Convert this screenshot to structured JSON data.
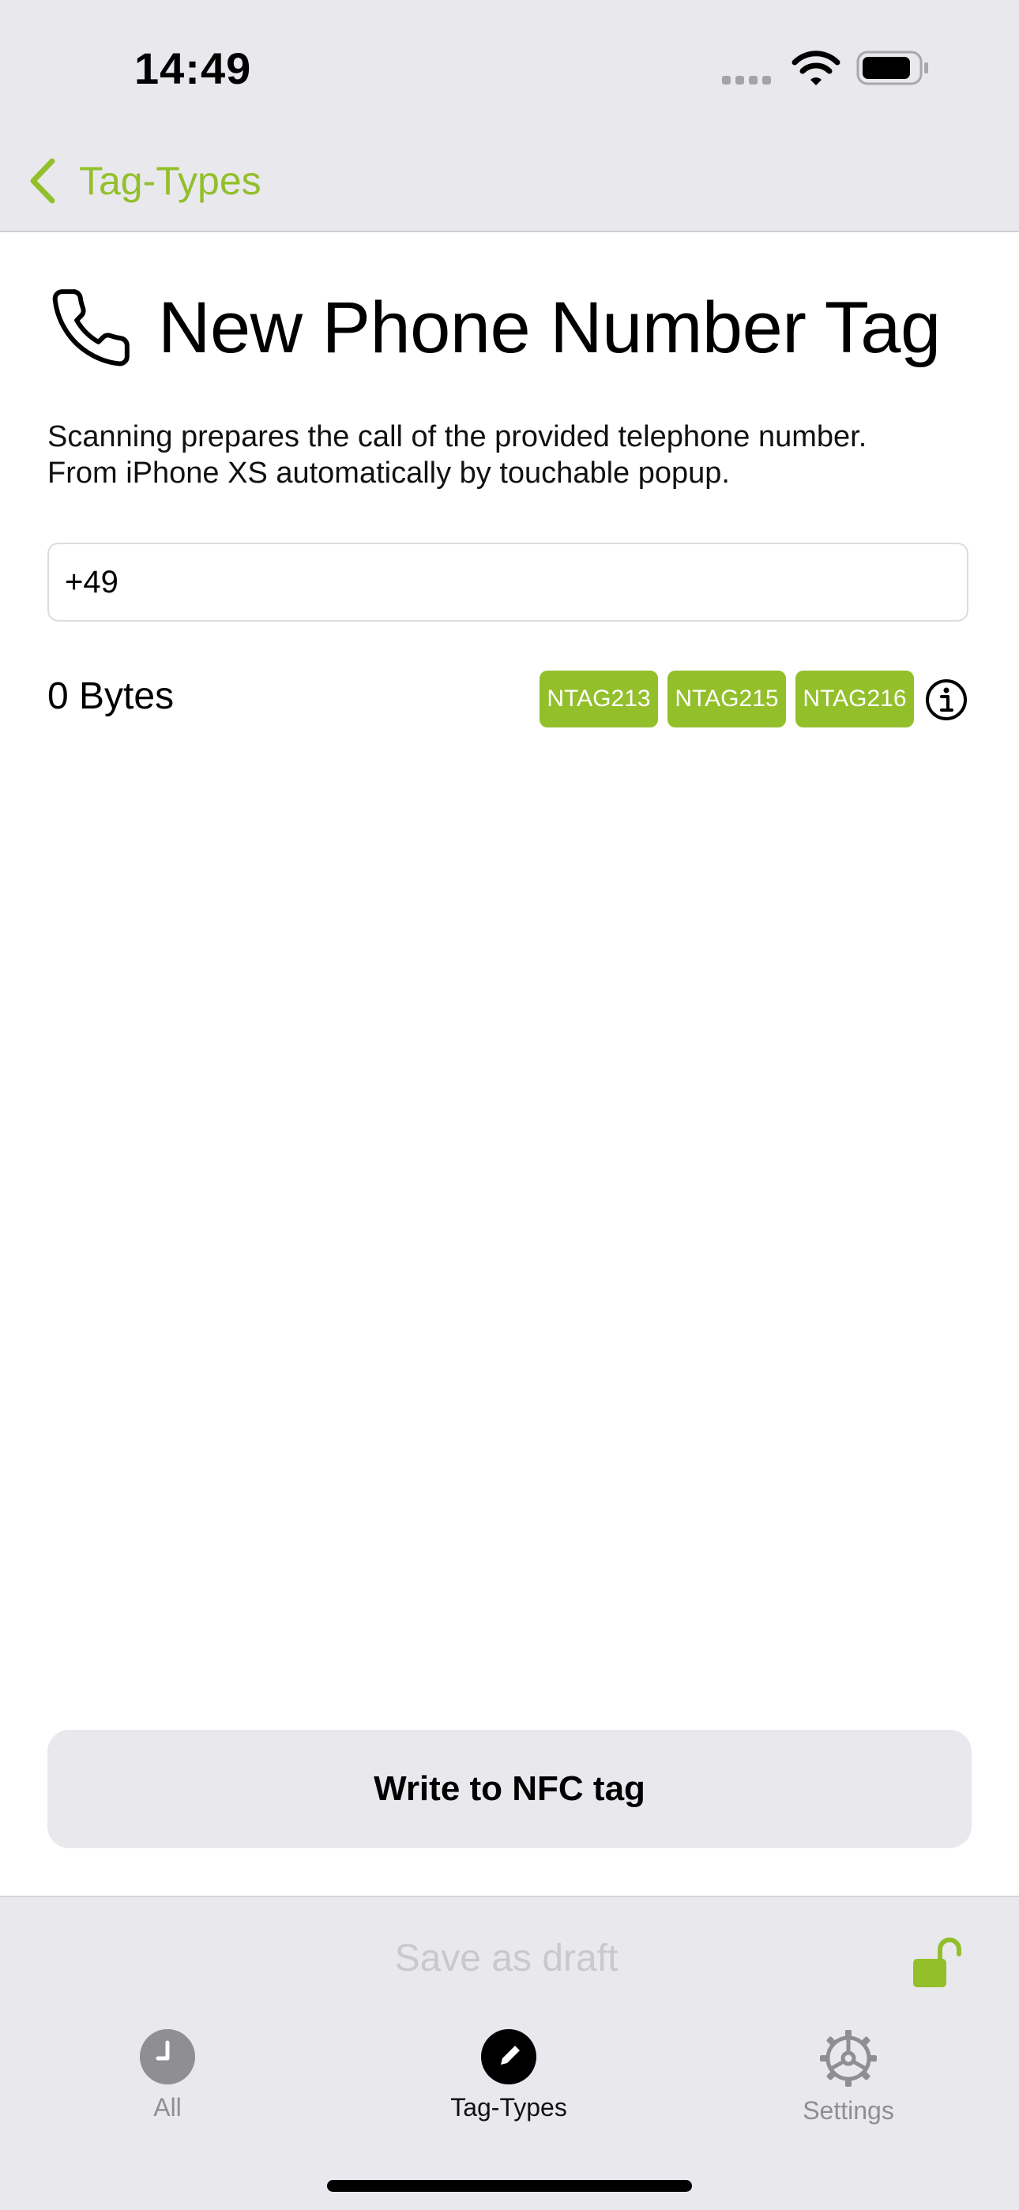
{
  "status_bar": {
    "time": "14:49",
    "icons": [
      "cellular-signal-icon",
      "wifi-icon",
      "battery-icon"
    ]
  },
  "nav": {
    "back_label": "Tag-Types",
    "back_icon": "chevron-left-icon"
  },
  "page": {
    "title_icon": "phone-icon",
    "title": "New Phone Number Tag",
    "description_line1": "Scanning prepares the call of the provided telephone number.",
    "description_line2": "From iPhone XS automatically by touchable popup.",
    "phone_value": "+49",
    "bytes_label": "0 Bytes",
    "chips": [
      "NTAG213",
      "NTAG215",
      "NTAG216"
    ],
    "info_icon": "info-circle-icon"
  },
  "actions": {
    "write_label": "Write to NFC tag",
    "save_draft_label": "Save as draft",
    "lock_icon": "unlocked-padlock-icon"
  },
  "tab_bar": {
    "tabs": [
      {
        "label": "All",
        "icon": "clock-icon",
        "active": false
      },
      {
        "label": "Tag-Types",
        "icon": "pencil-icon",
        "active": true
      },
      {
        "label": "Settings",
        "icon": "gear-icon",
        "active": false
      }
    ]
  },
  "colors": {
    "accent": "#93bf2b",
    "bar_background": "#e9e9ed",
    "inactive": "#8e8e93"
  }
}
